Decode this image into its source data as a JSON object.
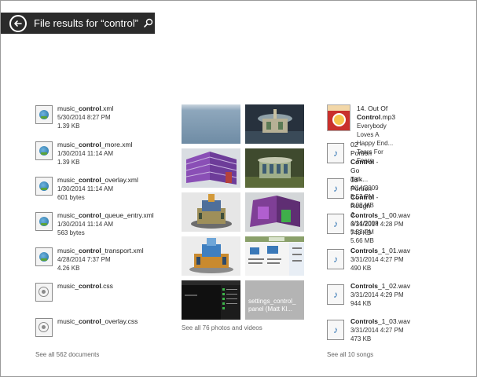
{
  "header": {
    "title": "File results for “control”"
  },
  "documents": {
    "items": [
      {
        "name_pre": "music_",
        "name_bold": "control",
        "name_post": ".xml",
        "date": "5/30/2014 8:27 PM",
        "size": "1.39 KB",
        "kind": "xml"
      },
      {
        "name_pre": "music_",
        "name_bold": "control",
        "name_post": "_more.xml",
        "date": "1/30/2014 11:14 AM",
        "size": "1.39 KB",
        "kind": "xml"
      },
      {
        "name_pre": "music_",
        "name_bold": "control",
        "name_post": "_overlay.xml",
        "date": "1/30/2014 11:14 AM",
        "size": "601 bytes",
        "kind": "xml"
      },
      {
        "name_pre": "music_",
        "name_bold": "control",
        "name_post": "_queue_entry.xml",
        "date": "1/30/2014 11:14 AM",
        "size": "563 bytes",
        "kind": "xml"
      },
      {
        "name_pre": "music_",
        "name_bold": "control",
        "name_post": "_transport.xml",
        "date": "4/28/2014 7:37 PM",
        "size": "4.26 KB",
        "kind": "xml"
      },
      {
        "name_pre": "music_",
        "name_bold": "control",
        "name_post": ".css",
        "date": "",
        "size": "",
        "kind": "css"
      },
      {
        "name_pre": "music_",
        "name_bold": "control",
        "name_post": "_overlay.css",
        "date": "",
        "size": "",
        "kind": "css"
      }
    ],
    "see_all": "See all 562 documents"
  },
  "photos": {
    "last_caption": "settings_control_ panel (Matt Kl...",
    "see_all": "See all 76 photos and videos"
  },
  "songs": {
    "items": [
      {
        "title_pre": "14. Out Of ",
        "title_bold": "Control",
        "title_post": ".mp3",
        "line2": "Everybody Loves A Happy End...",
        "line3": "Tears For Fears",
        "art": "album"
      },
      {
        "title_pre": "02 - Portion ",
        "title_bold": "Control",
        "title_post": " - Go Talk...",
        "line2": "4/14/2009 5:53 PM",
        "line3": "6.08 MB",
        "art": "audio"
      },
      {
        "title_pre": "03 - Portion ",
        "title_bold": "Control",
        "title_post": " - Rough J...",
        "line2": "4/14/2009 5:53 PM",
        "line3": "5.66 MB",
        "art": "audio"
      },
      {
        "title_pre": "",
        "title_bold": "Controls",
        "title_post": "_1_00.wav",
        "line2": "3/31/2014 4:28 PM",
        "line3": "749 KB",
        "art": "audio"
      },
      {
        "title_pre": "",
        "title_bold": "Controls",
        "title_post": "_1_01.wav",
        "line2": "3/31/2014 4:27 PM",
        "line3": "490 KB",
        "art": "audio"
      },
      {
        "title_pre": "",
        "title_bold": "Controls",
        "title_post": "_1_02.wav",
        "line2": "3/31/2014 4:29 PM",
        "line3": "944 KB",
        "art": "audio"
      },
      {
        "title_pre": "",
        "title_bold": "Controls",
        "title_post": "_1_03.wav",
        "line2": "3/31/2014 4:27 PM",
        "line3": "473 KB",
        "art": "audio"
      }
    ],
    "see_all": "See all 10 songs"
  }
}
